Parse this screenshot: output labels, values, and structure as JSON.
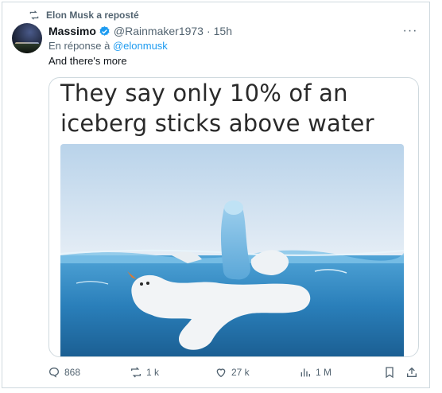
{
  "repost_banner": {
    "text": "Elon Musk a reposté",
    "icon": "repost-icon"
  },
  "author": {
    "name": "Massimo",
    "handle": "@Rainmaker1973",
    "separator": "·",
    "time": "15h",
    "verified_icon": "verified-badge-icon",
    "verified_color": "#1d9bf0"
  },
  "reply_context": {
    "prefix": "En réponse à",
    "mention": "@elonmusk"
  },
  "tweet": {
    "text": "And there's more"
  },
  "media": {
    "line1": "They say only 10% of an",
    "line2": "iceberg sticks above water"
  },
  "actions": {
    "replies": "868",
    "reposts": "1 k",
    "likes": "27 k",
    "views": "1 M"
  },
  "colors": {
    "accent": "#1d9bf0",
    "secondary_text": "#536471",
    "border": "#cfd9de"
  }
}
